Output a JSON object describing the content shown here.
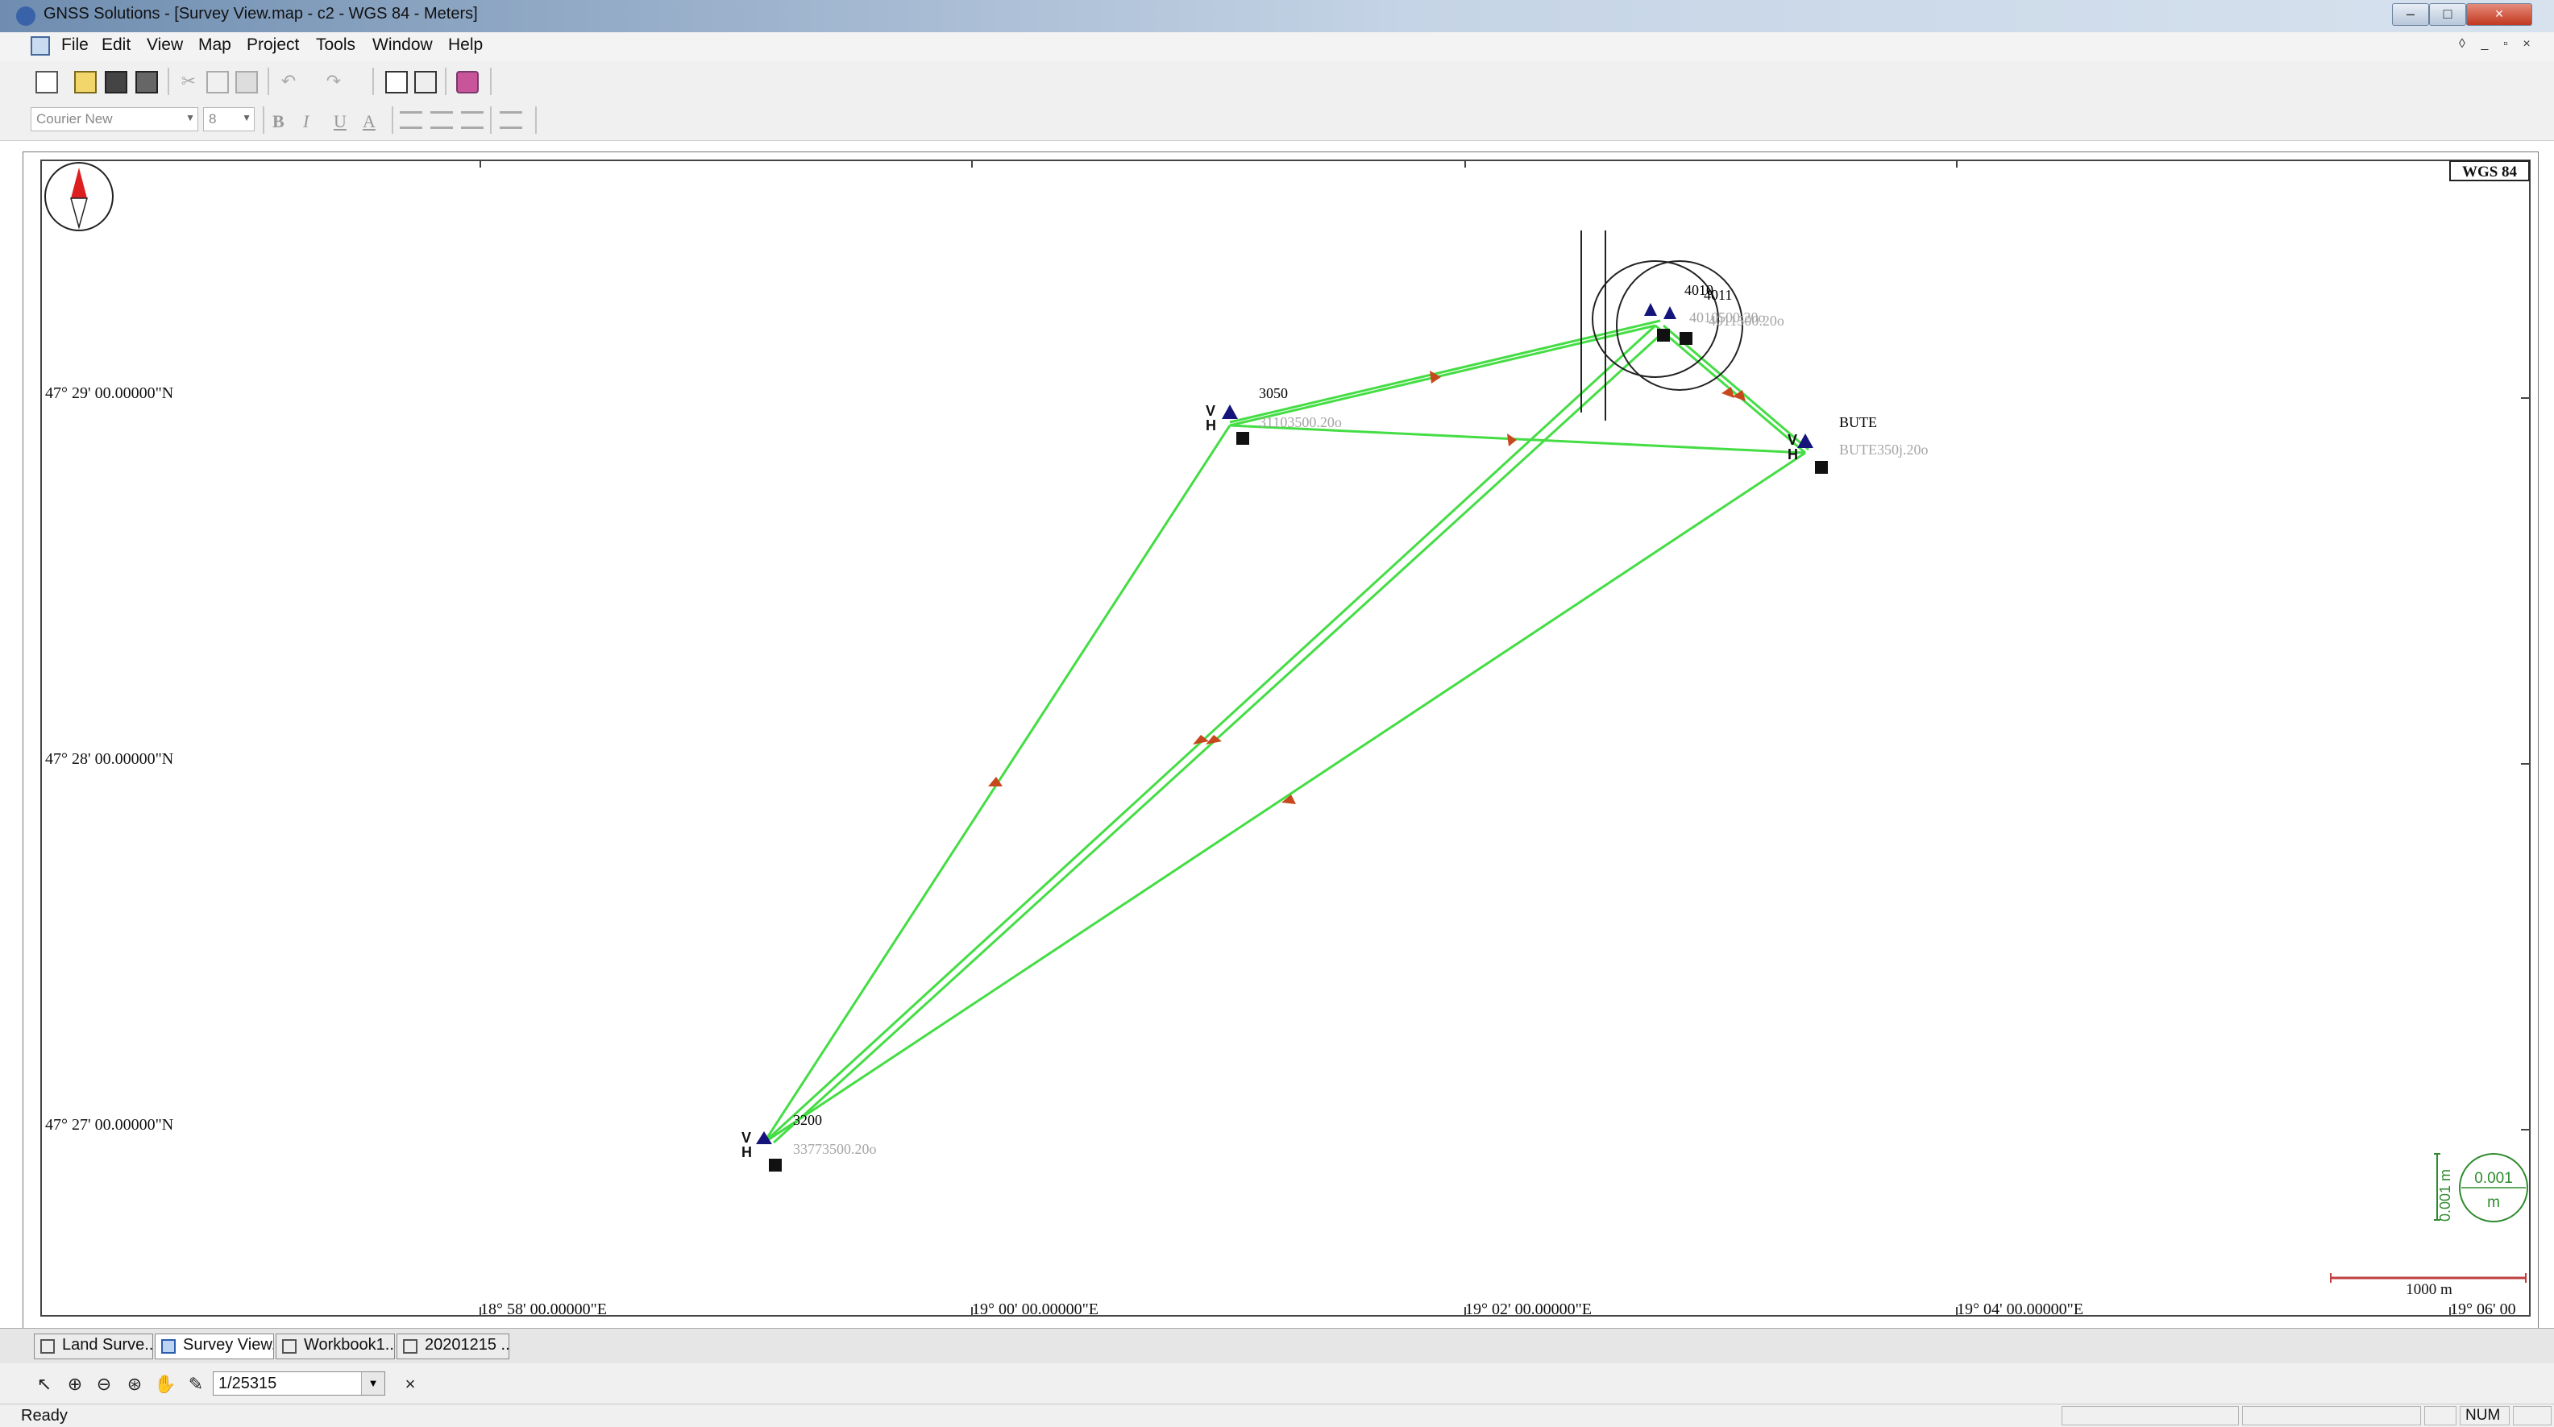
{
  "window": {
    "title": "GNSS Solutions - [Survey View.map - c2 - WGS 84 - Meters]",
    "controls": [
      "–",
      "□",
      "×"
    ]
  },
  "menu": {
    "items": [
      "File",
      "Edit",
      "View",
      "Map",
      "Project",
      "Tools",
      "Window",
      "Help"
    ],
    "mdi_controls": [
      "◊",
      "_",
      "▫",
      "×"
    ]
  },
  "format_toolbar": {
    "font": "Courier New",
    "size": "8",
    "bold": "B",
    "italic": "I",
    "underline": "U",
    "color": "A"
  },
  "map": {
    "datum_badge": "WGS 84",
    "lat_labels": [
      "47° 29' 00.00000\"N",
      "47° 28' 00.00000\"N",
      "47° 27' 00.00000\"N"
    ],
    "lon_labels": [
      "18° 58' 00.00000\"E",
      "19° 00' 00.00000\"E",
      "19° 02' 00.00000\"E",
      "19° 04' 00.00000\"E",
      "19° 06' 00"
    ],
    "points": [
      {
        "id": "3050",
        "obs": "31103500.20o"
      },
      {
        "id": "BUTE",
        "obs": "BUTE350j.20o"
      },
      {
        "id": "3200",
        "obs": "33773500.20o"
      },
      {
        "id": "4010",
        "obs": "4010500.20o"
      },
      {
        "id": "4011",
        "obs": "4011500.20o"
      }
    ],
    "vh_marker": {
      "v": "V",
      "h": "H"
    },
    "error_ellipse_scale": {
      "vertical_label": "0.001 m",
      "value": "0.001",
      "unit": "m"
    },
    "scale_bar_label": "1000 m",
    "colors": {
      "vector": "#44dd44",
      "arrow": "#c8481e",
      "label": "#000000",
      "obs_label": "#a5a5a5",
      "marker": "#14147a"
    }
  },
  "tabs": [
    "Land Surve...",
    "Survey View...",
    "Workbook1...",
    "20201215 ..."
  ],
  "map_toolbar": {
    "scale_value": "1/25315",
    "clear": "×"
  },
  "status": {
    "text": "Ready",
    "num": "NUM"
  }
}
